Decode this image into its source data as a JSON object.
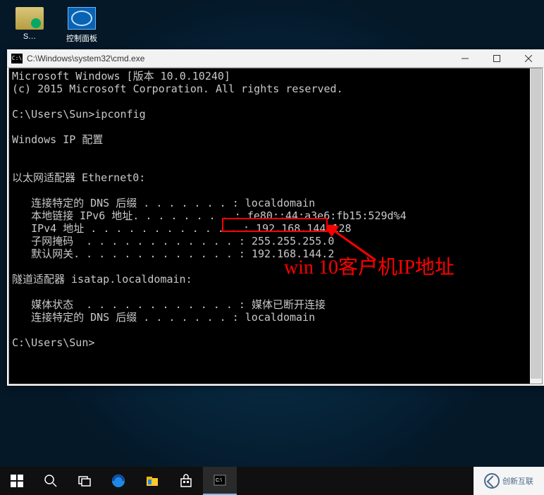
{
  "desktop": {
    "icon1_label": "S…",
    "icon2_label": "控制面板"
  },
  "window": {
    "title": "C:\\Windows\\system32\\cmd.exe",
    "lines": [
      "Microsoft Windows [版本 10.0.10240]",
      "(c) 2015 Microsoft Corporation. All rights reserved.",
      "",
      "C:\\Users\\Sun>ipconfig",
      "",
      "Windows IP 配置",
      "",
      "",
      "以太网适配器 Ethernet0:",
      "",
      "   连接特定的 DNS 后缀 . . . . . . . : localdomain",
      "   本地链接 IPv6 地址. . . . . . . . : fe80::44:a3e6:fb15:529d%4",
      "   IPv4 地址 . . . . . . . . . . . . : 192.168.144.128",
      "   子网掩码  . . . . . . . . . . . . : 255.255.255.0",
      "   默认网关. . . . . . . . . . . . . : 192.168.144.2",
      "",
      "隧道适配器 isatap.localdomain:",
      "",
      "   媒体状态  . . . . . . . . . . . . : 媒体已断开连接",
      "   连接特定的 DNS 后缀 . . . . . . . : localdomain",
      "",
      "C:\\Users\\Sun>"
    ]
  },
  "annotation": {
    "label": "win 10客户机IP地址",
    "highlighted_value": "192.168.144.128"
  },
  "watermark": {
    "text": "创新互联"
  }
}
